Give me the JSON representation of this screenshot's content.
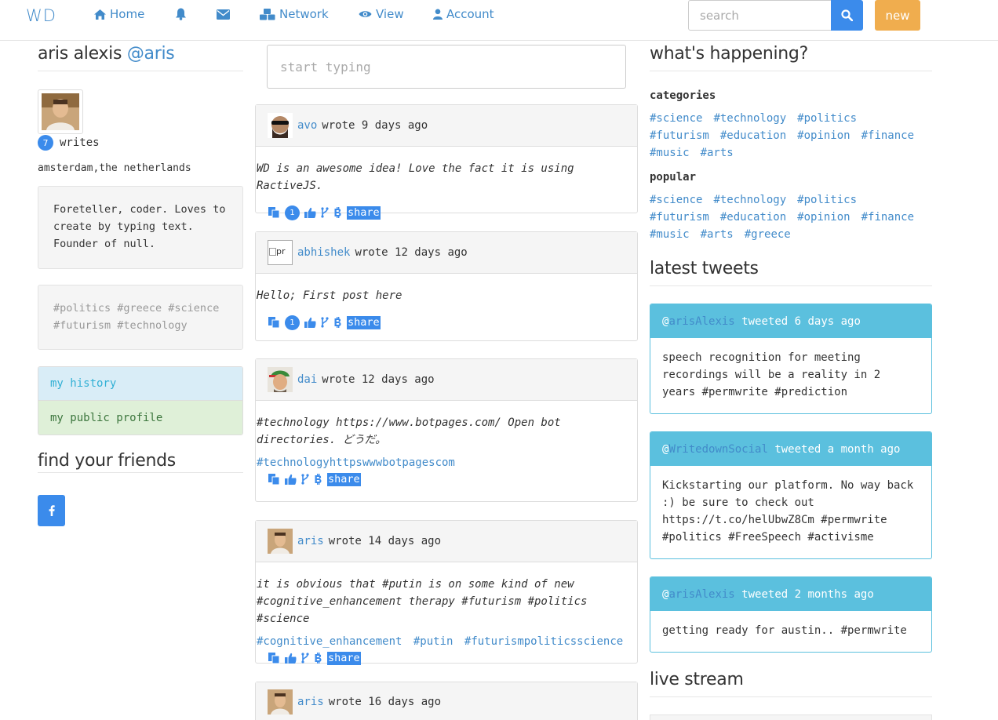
{
  "nav": {
    "logo": "WD",
    "home": "Home",
    "network": "Network",
    "view": "View",
    "account": "Account",
    "search_placeholder": "search",
    "new_label": "new"
  },
  "profile": {
    "name": "aris alexis",
    "handle": "@aris",
    "writes_count": "7",
    "writes_label": "writes",
    "location": "amsterdam,the netherlands",
    "bio": "Foreteller, coder. Loves to create by typing text. Founder of null.",
    "tags": "#politics #greece #science #futurism #technology",
    "menu": [
      "my history",
      "my public profile"
    ],
    "friends_title": "find your friends"
  },
  "compose": {
    "placeholder": "start typing"
  },
  "posts": [
    {
      "author": "avo",
      "meta": "wrote 9 days ago",
      "text": "WD is an awesome idea! Love the fact it is using RactiveJS.",
      "tags": [],
      "count": "1",
      "share": "share"
    },
    {
      "author": "abhishek",
      "meta": "wrote 12 days ago",
      "avatar_alt": "pr",
      "text": "Hello; First post here",
      "tags": [],
      "count": "1",
      "share": "share"
    },
    {
      "author": "dai",
      "meta": "wrote 12 days ago",
      "text": "#technology https://www.botpages.com/ Open bot directories. どうだ。",
      "tags": [
        "#technologyhttpswwwbotpagescom"
      ],
      "share": "share"
    },
    {
      "author": "aris",
      "meta": "wrote 14 days ago",
      "text": "it is obvious that #putin is on some kind of new #cognitive_enhancement therapy #futurism #politics #science",
      "tags": [
        "#cognitive_enhancement",
        "#putin",
        "#futurismpoliticsscience"
      ],
      "share": "share"
    },
    {
      "author": "aris",
      "meta": "wrote 16 days ago"
    }
  ],
  "sidebar": {
    "happening_title": "what's happening?",
    "categories_label": "categories",
    "categories": [
      "#science",
      "#technology",
      "#politics",
      "#futurism",
      "#education",
      "#opinion",
      "#finance",
      "#music",
      "#arts"
    ],
    "popular_label": "popular",
    "popular": [
      "#science",
      "#technology",
      "#politics",
      "#futurism",
      "#education",
      "#opinion",
      "#finance",
      "#music",
      "#arts",
      "#greece"
    ],
    "tweets_title": "latest tweets",
    "tweets": [
      {
        "at": "@",
        "user": "arisAlexis",
        "meta": "tweeted 6 days ago",
        "text": "speech recognition for meeting recordings will be a reality in 2 years #permwrite #prediction"
      },
      {
        "at": "@",
        "user": "WritedownSocial",
        "meta": "tweeted a month ago",
        "text": "Kickstarting our platform. No way back :) be sure to check out https://t.co/helUbwZ8Cm #permwrite #politics #FreeSpeech #activisme"
      },
      {
        "at": "@",
        "user": "arisAlexis",
        "meta": "tweeted 2 months ago",
        "text": "getting ready for austin.. #permwrite"
      }
    ],
    "live_title": "live stream"
  },
  "colors": {
    "primary": "#3b8beb",
    "link": "#428bca",
    "warning": "#f0ad4e",
    "info": "#5bc0de"
  }
}
